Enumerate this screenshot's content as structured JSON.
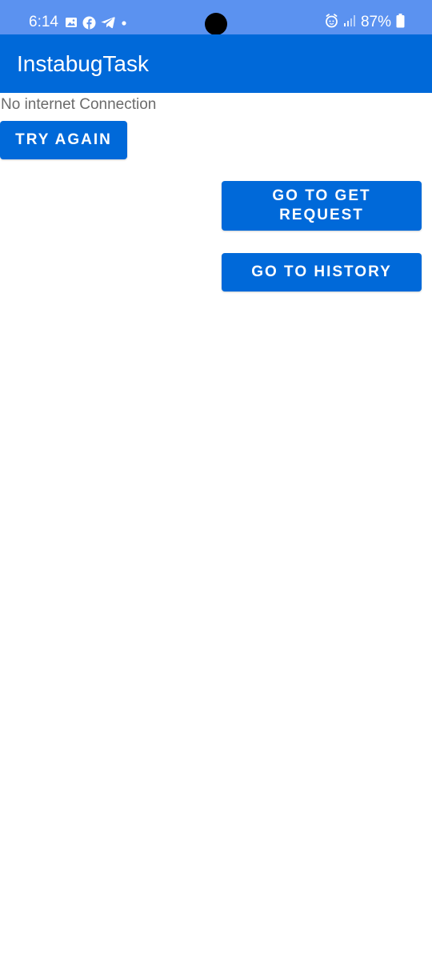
{
  "status_bar": {
    "time": "6:14",
    "battery_percent": "87%",
    "background_color": "#5b92f0",
    "left_icons": [
      "gallery-icon",
      "facebook-icon",
      "telegram-icon",
      "dot-icon"
    ],
    "right_icons": [
      "alarm-icon",
      "signal-icon",
      "battery-icon"
    ]
  },
  "app_bar": {
    "title": "InstabugTask",
    "background_color": "#0069d9"
  },
  "main": {
    "status_message": "No internet Connection",
    "try_again_label": "TRY AGAIN",
    "get_request_label": "GO TO GET REQUEST",
    "history_label": "GO TO HISTORY",
    "button_color": "#0069d9"
  }
}
